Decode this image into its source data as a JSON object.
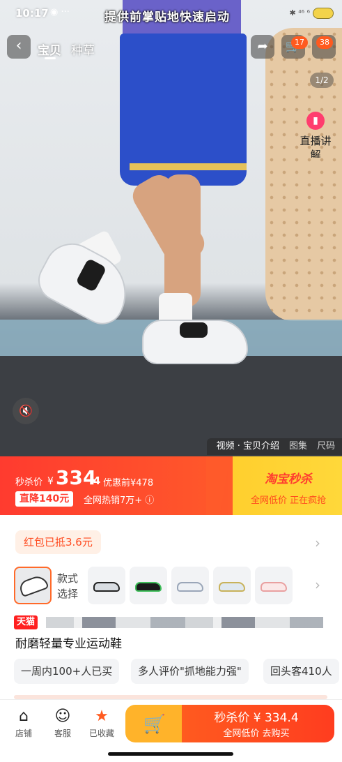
{
  "status": {
    "time": "10:17",
    "dots": "◉ ···",
    "right": "✱ ⁴⁶ ⁶"
  },
  "video": {
    "caption": "提供前掌贴地快速启动",
    "tabs": [
      "宝贝",
      "种草"
    ],
    "cart_badge": "17",
    "more_badge": "38",
    "counter": "1/2",
    "live_label": "直播讲解",
    "media_tabs": [
      "视频 · 宝贝介绍",
      "图集",
      "尺码"
    ]
  },
  "price_banner": {
    "label": "秒杀价",
    "yen": "¥",
    "price": "334",
    "price_dec": ".4",
    "coupon_price": "优惠前¥478",
    "drop": "直降140元",
    "hot": "全网热销7万+ ⓘ",
    "brand": "淘宝秒杀",
    "sub": "全网低价 正在疯抢",
    "colors": {
      "red": "#ff3b2f",
      "yellow": "#ffd83a"
    }
  },
  "product": {
    "red_packet": "红包已抵3.6元",
    "sku_label": "款式选择",
    "sku_thumb_colors": [
      "#222222",
      "#1a1a1a",
      "#cfd6e0",
      "#c8b25a",
      "#e9a0a0"
    ],
    "tmall_badge": "天猫",
    "title": "耐磨轻量专业运动鞋",
    "tags": [
      "一周内100+人已买",
      "多人评价\"抓地能力强\"",
      "回头客410人"
    ]
  },
  "bottom_bar": {
    "shop": "店铺",
    "service": "客服",
    "favorited": "已收藏",
    "buy_main": "秒杀价 ¥ 334.4",
    "buy_sub": "全网低价 去购买"
  }
}
